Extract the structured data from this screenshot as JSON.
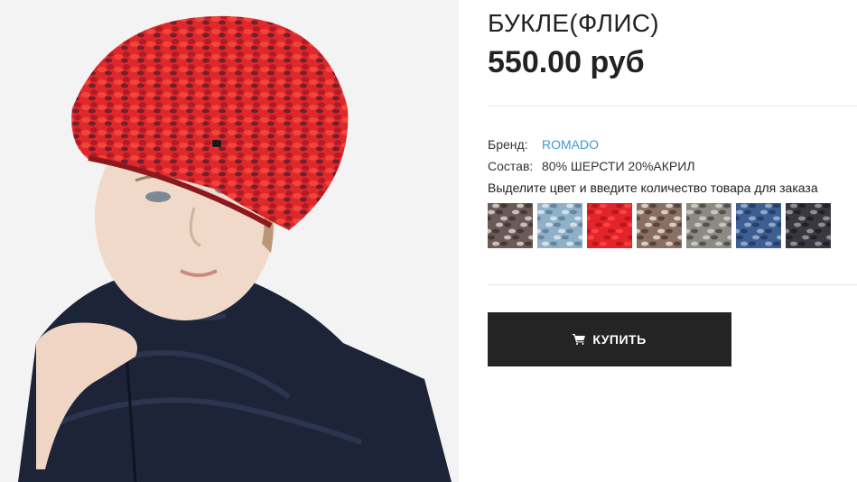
{
  "product": {
    "title": "БУКЛЕ(ФЛИС)",
    "price": "550.00 руб",
    "image_alt_icon": "product-photo-beret",
    "brand_label": "Бренд:",
    "brand_value": "ROMADO",
    "composition_label": "Состав:",
    "composition_value": "80% ШЕРСТИ 20%АКРИЛ",
    "hint": "Выделите цвет и введите количество товара для заказа",
    "swatches": [
      {
        "name": "brown-white",
        "colors": [
          "#6b5a57",
          "#d8d2ce",
          "#3e3432"
        ]
      },
      {
        "name": "light-blue",
        "colors": [
          "#8fb0c9",
          "#dfe8ef",
          "#5d7f9a"
        ]
      },
      {
        "name": "red",
        "colors": [
          "#e4242b",
          "#b5151c",
          "#ff4a45"
        ]
      },
      {
        "name": "beige-brown",
        "colors": [
          "#8a6f62",
          "#e8ddd5",
          "#4d3d37"
        ]
      },
      {
        "name": "grey-beige",
        "colors": [
          "#8c8a85",
          "#d3d0c8",
          "#4a4845"
        ]
      },
      {
        "name": "blue",
        "colors": [
          "#3d5f92",
          "#9fb4d2",
          "#243a63"
        ]
      },
      {
        "name": "dark-grey",
        "colors": [
          "#3a3840",
          "#9c9aa2",
          "#1f1d24"
        ]
      }
    ],
    "buy_label": "КУПИТЬ"
  },
  "colors": {
    "accent": "#3d9ad8",
    "button_bg": "#242424"
  }
}
